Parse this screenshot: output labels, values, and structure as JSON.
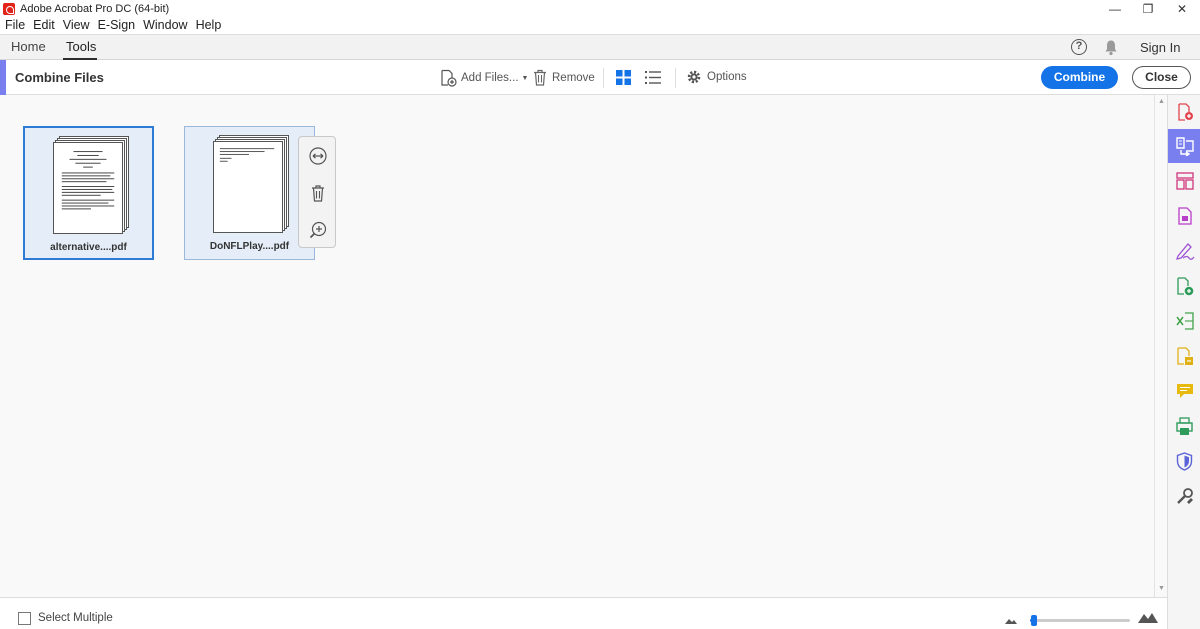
{
  "window": {
    "title": "Adobe Acrobat Pro DC (64-bit)",
    "minimize_glyph": "—",
    "maximize_glyph": "❐",
    "close_glyph": "✕"
  },
  "menu": [
    "File",
    "Edit",
    "View",
    "E-Sign",
    "Window",
    "Help"
  ],
  "nav": {
    "tabs": [
      "Home",
      "Tools"
    ],
    "active_tab": "Tools",
    "sign_in": "Sign In",
    "help_glyph": "?"
  },
  "toolbar": {
    "title": "Combine Files",
    "add_files": "Add Files...",
    "remove": "Remove",
    "options": "Options",
    "combine": "Combine",
    "close": "Close",
    "accent_color": "#7a7ff0"
  },
  "files": [
    {
      "name": "alternative....pdf",
      "selected": true
    },
    {
      "name": "DoNFLPlay....pdf",
      "selected": false
    }
  ],
  "bottom": {
    "select_multiple": "Select Multiple",
    "zoom_level": 0.04
  },
  "right_rail": {
    "icons": [
      "create-pdf-icon",
      "combine-files-icon",
      "organize-pages-icon",
      "export-pdf-icon",
      "fill-sign-icon",
      "edit-pdf-icon",
      "export-spreadsheet-icon",
      "scan-ocr-icon",
      "comment-icon",
      "print-production-icon",
      "protect-icon",
      "more-tools-icon"
    ],
    "active": "combine-files-icon"
  },
  "colors": {
    "brand_red": "#e2231a",
    "primary_blue": "#1473e6",
    "selection_blue": "#2d7bd4"
  }
}
